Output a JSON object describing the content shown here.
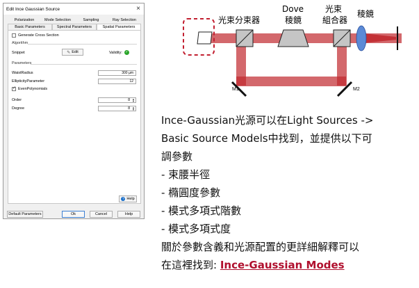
{
  "dialog": {
    "title": "Edit Ince Gaussian Source",
    "tabs_top": [
      "Polarization",
      "Mode Selection",
      "Sampling",
      "Ray Selection"
    ],
    "tabs_bottom": [
      "Basic Parameters",
      "Spectral Parameters",
      "Spatial Parameters"
    ],
    "active_tab": "Spatial Parameters",
    "generate_cross_section": "Generate Cross Section",
    "algorithm_label": "Algorithm",
    "snippet_label": "Snippet",
    "edit_button": "Edit",
    "validity_label": "Validity:",
    "parameters_label": "Parameters",
    "waist_radius_label": "WaistRadius",
    "waist_radius_value": "300 µm",
    "ellipticity_label": "EllipticityParameter",
    "ellipticity_value": "12",
    "even_polynomials": "EvenPolynomials",
    "order_label": "Order",
    "order_value": "8",
    "degree_label": "Degree",
    "degree_value": "8",
    "help_button": "Help",
    "default_parameters": "Default Parameters",
    "ok": "Ok",
    "cancel": "Cancel",
    "help": "Help"
  },
  "diagram": {
    "beam_splitter": "光束分束器",
    "dove_line1": "Dove",
    "dove_line2": "稜鏡",
    "combiner_line1": "光束",
    "combiner_line2": "組合器",
    "lens": "稜鏡",
    "m1": "M1",
    "m2": "M2",
    "colors": {
      "beam": "#c0282d",
      "dashed": "#c21f30"
    }
  },
  "description": {
    "line1": "Ince-Gaussian光源可以在Light Sources ->",
    "line2": "Basic Source Models中找到，並提供以下可",
    "line3": "調參數",
    "item1": "- 束腰半徑",
    "item2": "- 橢圓度參數",
    "item3": "- 模式多項式階數",
    "item4": "- 模式多項式度",
    "more1": "關於參數含義和光源配置的更詳細解釋可以",
    "more2_prefix": "在這裡找到: ",
    "link": "Ince-Gaussian Modes"
  }
}
